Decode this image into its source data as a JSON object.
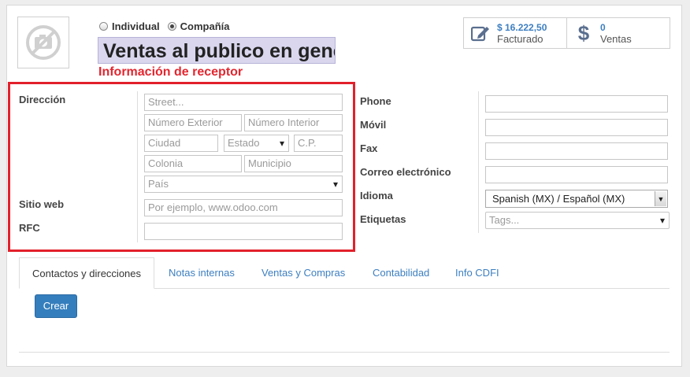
{
  "company_type": {
    "options": [
      {
        "label": "Individual",
        "checked": false
      },
      {
        "label": "Compañía",
        "checked": true
      }
    ]
  },
  "partner_name": "Ventas al publico en general",
  "annotation_label": "Información de receptor",
  "stats": {
    "invoiced": {
      "value": "$ 16.222,50",
      "label": "Facturado",
      "icon": "edit-icon"
    },
    "sales": {
      "value": "0",
      "label": "Ventas",
      "icon": "dollar-icon"
    }
  },
  "address": {
    "label": "Dirección",
    "street_placeholder": "Street...",
    "ext_number_placeholder": "Número Exterior",
    "int_number_placeholder": "Número Interior",
    "city_placeholder": "Ciudad",
    "state_placeholder": "Estado",
    "zip_placeholder": "C.P.",
    "colonia_placeholder": "Colonia",
    "municipio_placeholder": "Municipio",
    "country_placeholder": "País"
  },
  "website": {
    "label": "Sitio web",
    "placeholder": "Por ejemplo, www.odoo.com"
  },
  "rfc": {
    "label": "RFC",
    "value": ""
  },
  "contact": {
    "phone_label": "Phone",
    "mobile_label": "Móvil",
    "fax_label": "Fax",
    "email_label": "Correo electrónico",
    "language_label": "Idioma",
    "language_value": "Spanish (MX) / Español (MX)",
    "tags_label": "Etiquetas",
    "tags_placeholder": "Tags..."
  },
  "tabs": [
    {
      "label": "Contactos y direcciones",
      "active": true
    },
    {
      "label": "Notas internas",
      "active": false
    },
    {
      "label": "Ventas y Compras",
      "active": false
    },
    {
      "label": "Contabilidad",
      "active": false
    },
    {
      "label": "Info CDFI",
      "active": false
    }
  ],
  "create_button": "Crear",
  "colors": {
    "accent": "#3d7fc1",
    "annotation": "#e2202b",
    "primary_button": "#357ebd"
  }
}
